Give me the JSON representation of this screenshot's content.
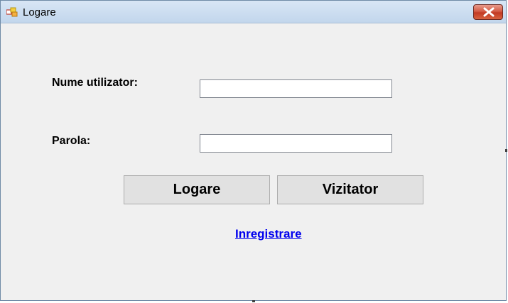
{
  "window": {
    "title": "Logare",
    "close_symbol": "✕",
    "app_icon": "winforms-app-icon"
  },
  "form": {
    "username_label": "Nume utilizator:",
    "username_value": "",
    "password_label": "Parola:",
    "password_value": "",
    "login_button": "Logare",
    "guest_button": "Vizitator",
    "register_link": "Inregistrare"
  },
  "colors": {
    "form_background": "#f0f0f0",
    "link": "#0000ee",
    "close_button": "#c23a24"
  }
}
